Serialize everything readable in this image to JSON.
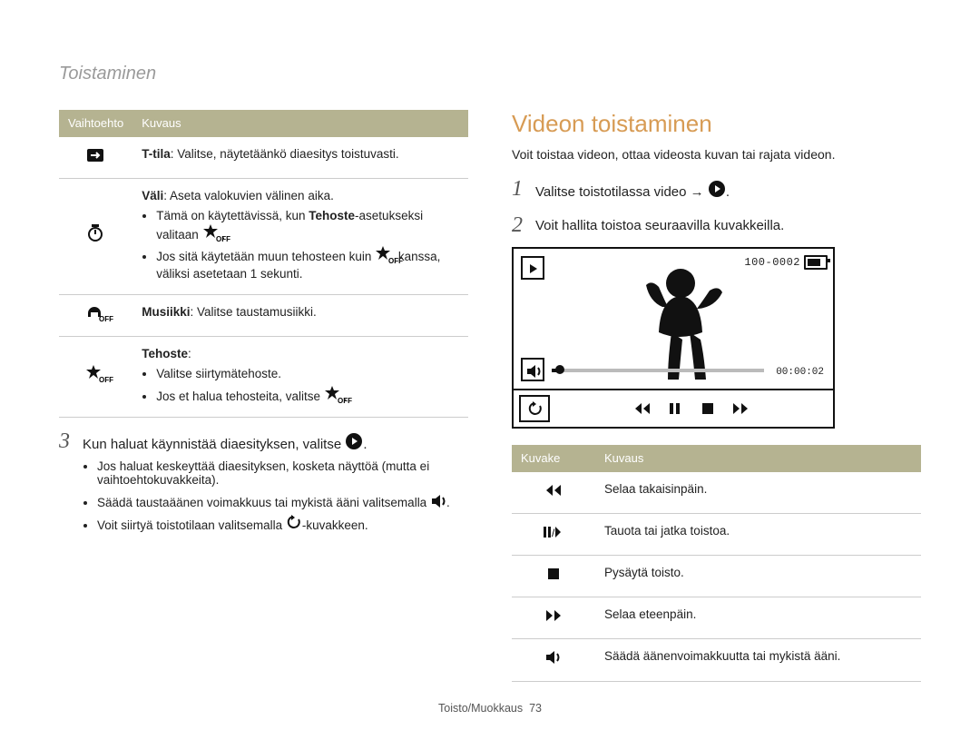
{
  "section_title": "Toistaminen",
  "left_table": {
    "headers": [
      "Vaihtoehto",
      "Kuvaus"
    ],
    "rows": [
      {
        "icon": "arrow-right-box-icon",
        "content": {
          "lead_bold": "T-tila",
          "lead_rest": ": Valitse, näytetäänkö diaesitys toistuvasti."
        }
      },
      {
        "icon": "interval-icon",
        "content": {
          "lead_bold": "Väli",
          "lead_rest": ": Aseta valokuvien välinen aika.",
          "bullets": [
            {
              "pre": "Tämä on käytettävissä, kun ",
              "bold1": "Tehoste",
              "mid": "-asetukseksi valitaan ",
              "icon": "star-off-icon",
              "post": "."
            },
            {
              "pre": "Jos sitä käytetään muun tehosteen kuin ",
              "icon": "star-off-icon",
              "post": " kanssa, väliksi asetetaan 1 sekunti."
            }
          ]
        }
      },
      {
        "icon": "headphones-off-icon",
        "content": {
          "lead_bold": "Musiikki",
          "lead_rest": ": Valitse taustamusiikki."
        }
      },
      {
        "icon": "star-off-icon",
        "content": {
          "lead_bold": "Tehoste",
          "lead_rest": ":",
          "bullets": [
            {
              "text": "Valitse siirtymätehoste."
            },
            {
              "pre": "Jos et halua tehosteita, valitse ",
              "icon": "star-off-icon",
              "post": "."
            }
          ]
        }
      }
    ]
  },
  "left_step": {
    "num": "3",
    "text_pre": "Kun haluat käynnistää diaesityksen, valitse ",
    "text_post": ".",
    "bullets": [
      "Jos haluat keskeyttää diaesityksen, kosketa näyttöä (mutta ei vaihtoehtokuvakkeita).",
      {
        "pre": "Säädä taustaäänen voimakkuus tai mykistä ääni valitsemalla ",
        "icon": "speaker-icon",
        "post": "."
      },
      {
        "pre": "Voit siirtyä toistotilaan valitsemalla ",
        "icon": "back-arrow-icon",
        "post": "-kuvakkeen."
      }
    ]
  },
  "right": {
    "heading": "Videon toistaminen",
    "intro": "Voit toistaa videon, ottaa videosta kuvan tai rajata videon.",
    "step1": {
      "num": "1",
      "text_pre": "Valitse toistotilassa video → ",
      "text_post": "."
    },
    "step2": {
      "num": "2",
      "text": "Voit hallita toistoa seuraavilla kuvakkeilla."
    },
    "video": {
      "file_label": "100-0002",
      "timecode": "00:00:02"
    },
    "icon_table": {
      "headers": [
        "Kuvake",
        "Kuvaus"
      ],
      "rows": [
        {
          "icon": "rewind-icon",
          "text": "Selaa takaisinpäin."
        },
        {
          "icon": "pause-play-icon",
          "text": "Tauota tai jatka toistoa."
        },
        {
          "icon": "stop-icon",
          "text": "Pysäytä toisto."
        },
        {
          "icon": "forward-icon",
          "text": "Selaa eteenpäin."
        },
        {
          "icon": "speaker-icon",
          "text": "Säädä äänenvoimakkuutta tai mykistä ääni."
        }
      ]
    }
  },
  "footer": {
    "text": "Toisto/Muokkaus",
    "page": "73"
  }
}
